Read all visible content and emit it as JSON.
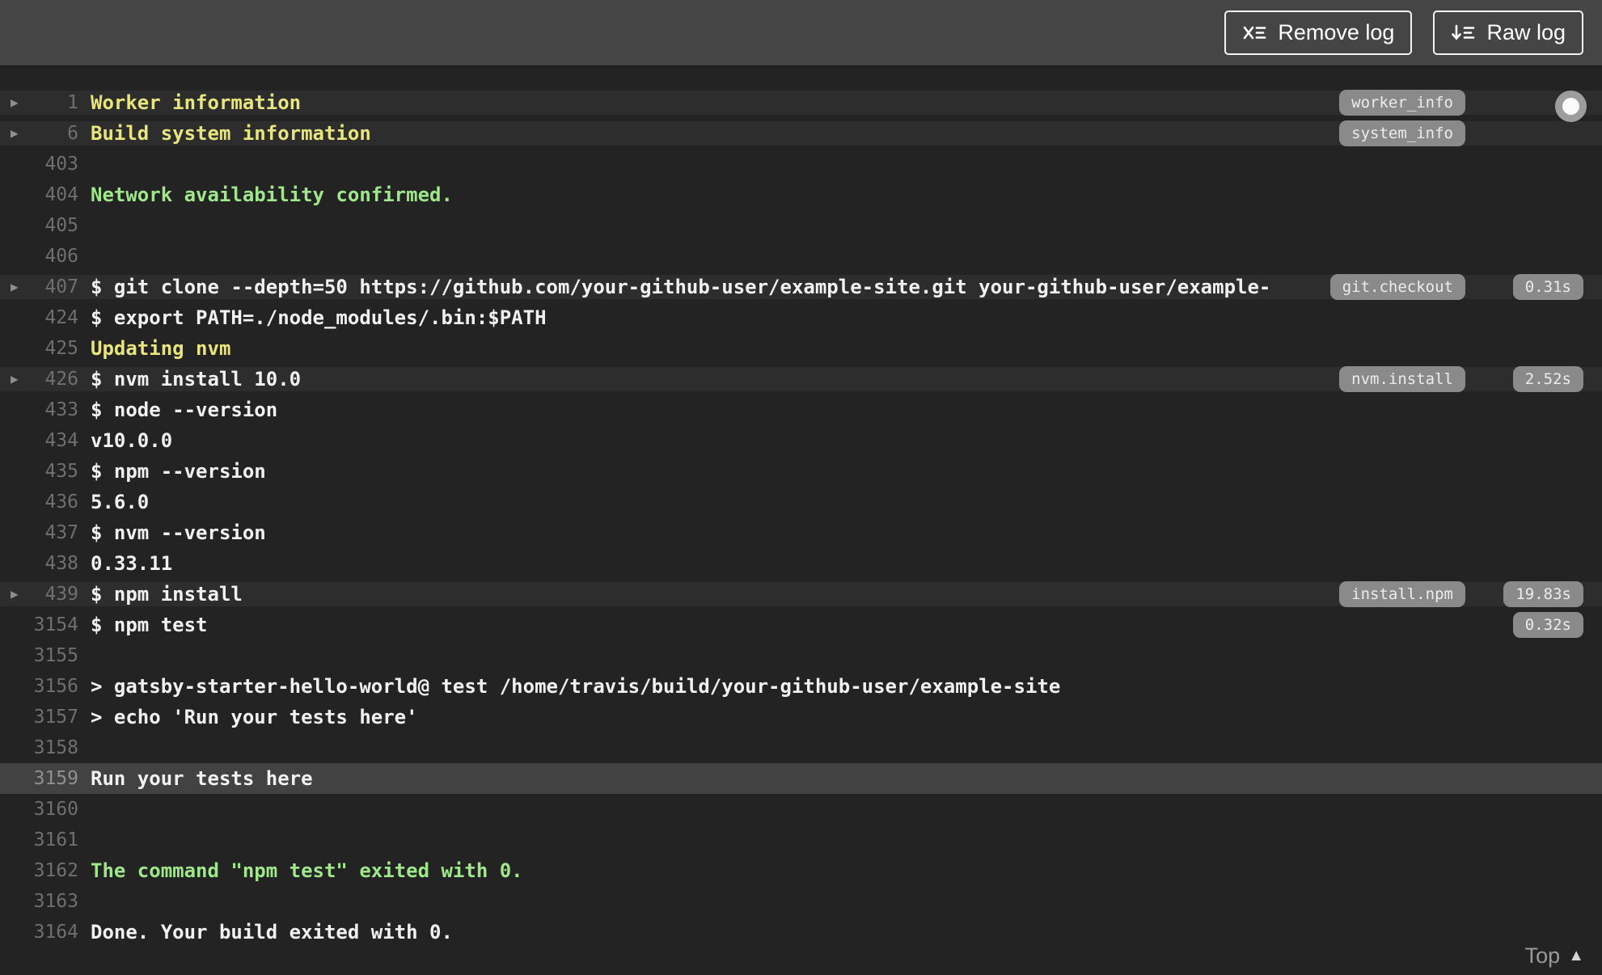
{
  "header": {
    "remove_log_label": "Remove log",
    "raw_log_label": "Raw log"
  },
  "footer": {
    "top_label": "Top"
  },
  "colors": {
    "header_bg": "#454545",
    "log_bg": "#232323",
    "fold_row_bg": "#2d2d2d",
    "selected_row_bg": "#424242",
    "text": "#f1f1f1",
    "yellow": "#e9e57e",
    "green": "#9fe78a",
    "line_number": "#6f6f6f",
    "pill_bg": "#8a8a8a"
  },
  "icons": [
    "remove-log-icon",
    "raw-log-icon",
    "fold-arrow-icon",
    "scroll-knob",
    "top-arrow-icon"
  ],
  "log": {
    "rows": [
      {
        "num": "1",
        "text": "Worker information",
        "color": "yellow",
        "fold": true,
        "tag": "worker_info"
      },
      {
        "num": "6",
        "text": "Build system information",
        "color": "yellow",
        "fold": true,
        "tag": "system_info"
      },
      {
        "num": "403",
        "text": ""
      },
      {
        "num": "404",
        "text": "Network availability confirmed.",
        "color": "green"
      },
      {
        "num": "405",
        "text": ""
      },
      {
        "num": "406",
        "text": ""
      },
      {
        "num": "407",
        "text": "$ git clone --depth=50 https://github.com/your-github-user/example-site.git your-github-user/example-",
        "fold": true,
        "tag": "git.checkout",
        "duration": "0.31s"
      },
      {
        "num": "424",
        "text": "$ export PATH=./node_modules/.bin:$PATH"
      },
      {
        "num": "425",
        "text": "Updating nvm",
        "color": "yellow"
      },
      {
        "num": "426",
        "text": "$ nvm install 10.0",
        "fold": true,
        "tag": "nvm.install",
        "duration": "2.52s"
      },
      {
        "num": "433",
        "text": "$ node --version"
      },
      {
        "num": "434",
        "text": "v10.0.0"
      },
      {
        "num": "435",
        "text": "$ npm --version"
      },
      {
        "num": "436",
        "text": "5.6.0"
      },
      {
        "num": "437",
        "text": "$ nvm --version"
      },
      {
        "num": "438",
        "text": "0.33.11"
      },
      {
        "num": "439",
        "text": "$ npm install",
        "fold": true,
        "tag": "install.npm",
        "duration": "19.83s"
      },
      {
        "num": "3154",
        "text": "$ npm test",
        "duration": "0.32s"
      },
      {
        "num": "3155",
        "text": ""
      },
      {
        "num": "3156",
        "text": "> gatsby-starter-hello-world@ test /home/travis/build/your-github-user/example-site"
      },
      {
        "num": "3157",
        "text": "> echo 'Run your tests here'"
      },
      {
        "num": "3158",
        "text": ""
      },
      {
        "num": "3159",
        "text": "Run your tests here",
        "selected": true
      },
      {
        "num": "3160",
        "text": ""
      },
      {
        "num": "3161",
        "text": ""
      },
      {
        "num": "3162",
        "text": "The command \"npm test\" exited with 0.",
        "color": "green"
      },
      {
        "num": "3163",
        "text": ""
      },
      {
        "num": "3164",
        "text": "Done. Your build exited with 0."
      }
    ]
  }
}
